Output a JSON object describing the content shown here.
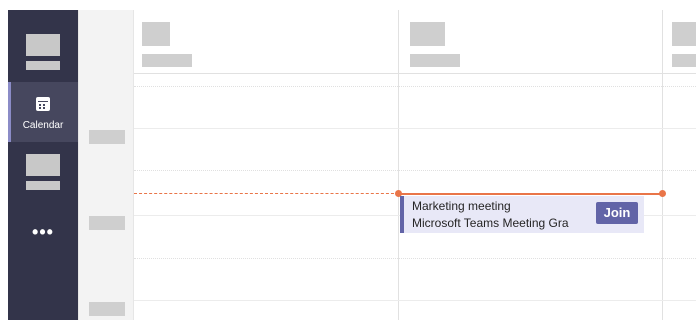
{
  "rail": {
    "active_item": {
      "label": "Calendar",
      "icon": "calendar-icon"
    },
    "more_label": "•••",
    "colors": {
      "background": "#33344a",
      "active": "#46475e",
      "accent": "#8b8cc7"
    }
  },
  "event": {
    "title": "Marketing meeting",
    "subtitle": "Microsoft Teams Meeting Gra",
    "join_label": "Join",
    "colors": {
      "background": "#e8e8f7",
      "accent": "#6264a7"
    }
  },
  "now_indicator_color": "#e97548"
}
